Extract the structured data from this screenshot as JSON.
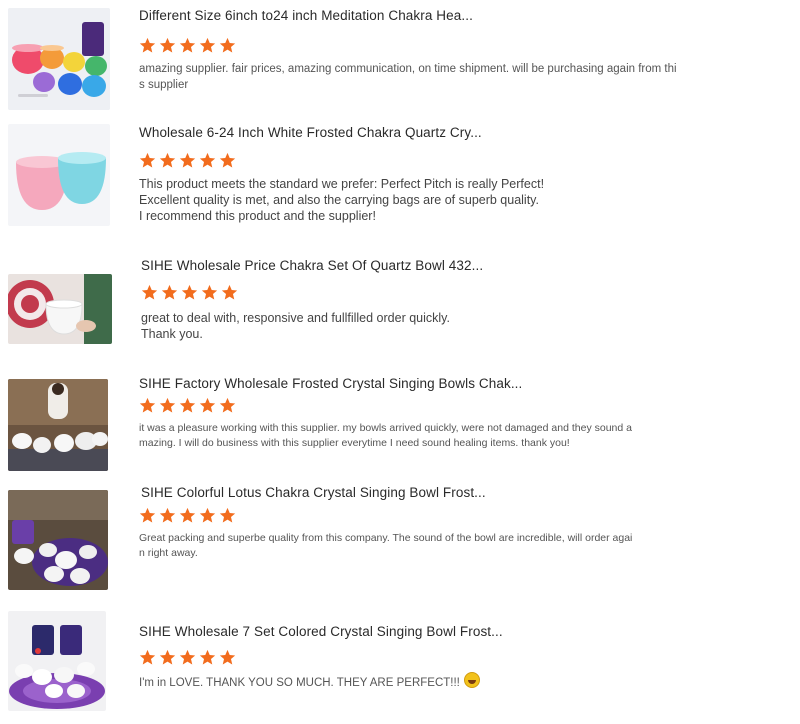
{
  "reviews": [
    {
      "title": "Different Size 6inch to24 inch Meditation Chakra Hea...",
      "rating": 5,
      "lines": [
        "amazing supplier. fair prices, amazing communication, on time shipment. will be purchasing again from thi",
        "s supplier"
      ]
    },
    {
      "title": "Wholesale 6-24 Inch White Frosted Chakra Quartz Cry...",
      "rating": 5,
      "lines": [
        "This product meets the standard we prefer: Perfect Pitch is really Perfect!",
        "Excellent quality is met, and also the carrying bags are of superb quality.",
        "I recommend this product and the supplier!"
      ]
    },
    {
      "title": "SIHE Wholesale Price Chakra Set Of Quartz Bowl 432...",
      "rating": 5,
      "lines": [
        "great to deal with, responsive and fullfilled order quickly.",
        "Thank you."
      ]
    },
    {
      "title": "SIHE Factory Wholesale Frosted Crystal Singing Bowls Chak...",
      "rating": 5,
      "lines": [
        "it was a pleasure working with this supplier. my bowls arrived quickly, were not damaged and they sound a",
        "mazing. I will do business with this supplier everytime I need sound healing items. thank you!"
      ]
    },
    {
      "title": "SIHE Colorful Lotus Chakra Crystal Singing Bowl Frost...",
      "rating": 5,
      "lines": [
        "Great packing and superbe quality from this company. The sound of the bowl are incredible, will order agai",
        "n right away."
      ]
    },
    {
      "title": "SIHE Wholesale 7 Set Colored Crystal Singing Bowl Frost...",
      "rating": 5,
      "lines": [
        "I'm in LOVE. THANK YOU SO MUCH. THEY ARE PERFECT!!!"
      ]
    }
  ],
  "colors": {
    "star": "#f26c1d",
    "title": "#2a2a2a",
    "text": "#555555"
  }
}
